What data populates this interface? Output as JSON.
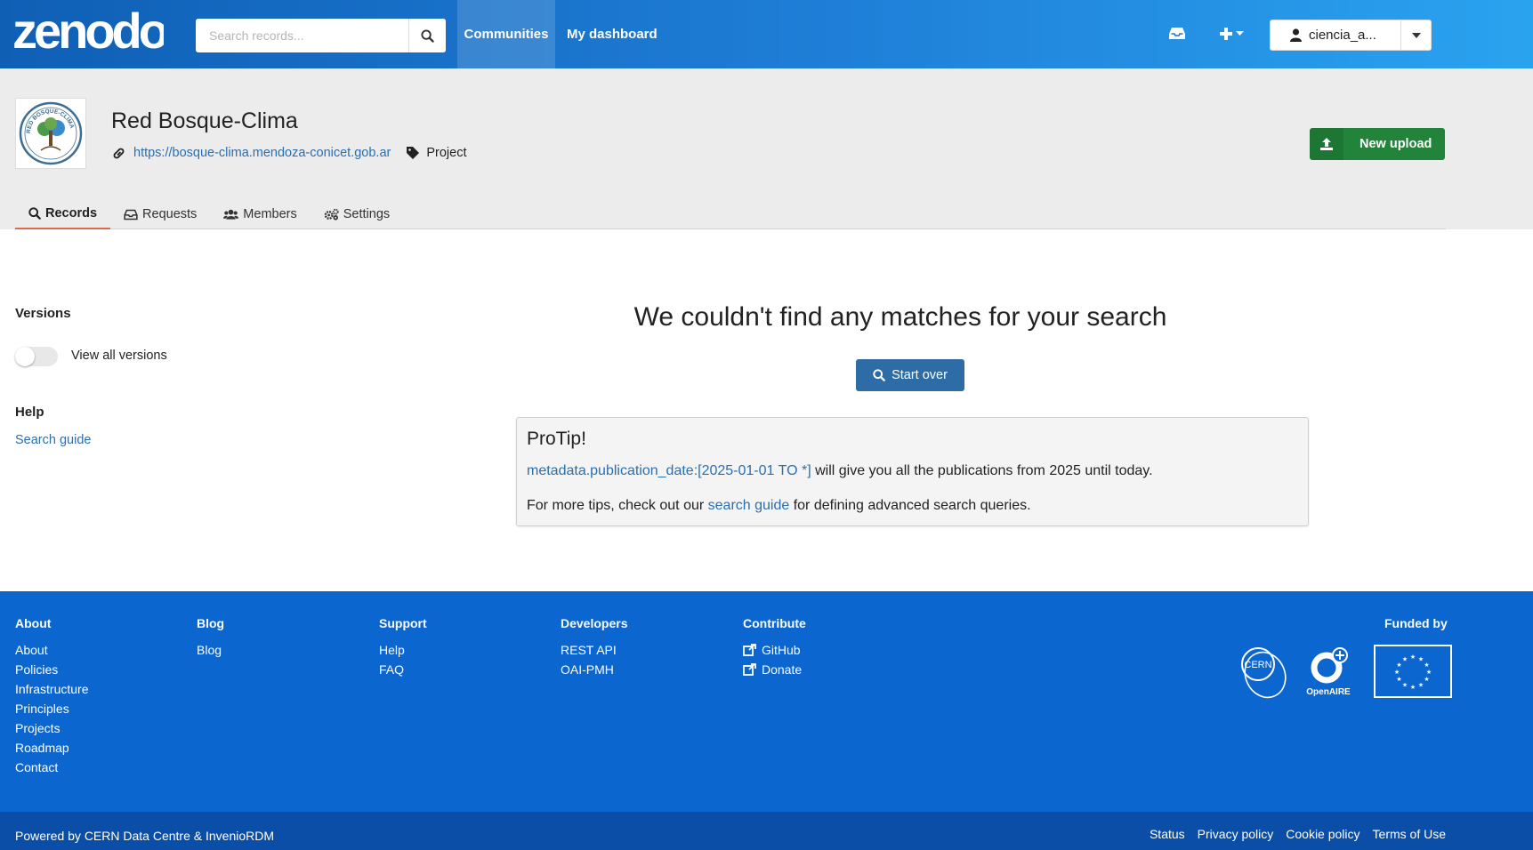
{
  "header": {
    "logo_text": "zenodo",
    "search_placeholder": "Search records...",
    "nav": {
      "communities": "Communities",
      "dashboard": "My dashboard"
    },
    "user": "ciencia_a..."
  },
  "community": {
    "title": "Red Bosque-Clima",
    "logo_text": "RED BOSQUE-CLIMA",
    "url": "https://bosque-clima.mendoza-conicet.gob.ar",
    "type": "Project",
    "new_upload": "New upload",
    "tabs": [
      {
        "label": "Records",
        "icon": "search-icon",
        "active": true
      },
      {
        "label": "Requests",
        "icon": "inbox-icon",
        "active": false
      },
      {
        "label": "Members",
        "icon": "users-icon",
        "active": false
      },
      {
        "label": "Settings",
        "icon": "cogs-icon",
        "active": false
      }
    ]
  },
  "sidebar": {
    "versions_heading": "Versions",
    "versions_toggle": "View all versions",
    "versions_toggle_on": false,
    "help_heading": "Help",
    "help_link": "Search guide"
  },
  "main": {
    "empty_title": "We couldn't find any matches for your search",
    "start_over": "Start over",
    "protip": {
      "title": "ProTip!",
      "query": "metadata.publication_date:[2025-01-01 TO *]",
      "line1_rest": " will give you all the publications from 2025 until today.",
      "line2_pre": "For more tips, check out our ",
      "line2_link": "search guide",
      "line2_post": " for defining advanced search queries."
    }
  },
  "footer": {
    "columns": [
      {
        "heading": "About",
        "items": [
          "About",
          "Policies",
          "Infrastructure",
          "Principles",
          "Projects",
          "Roadmap",
          "Contact"
        ]
      },
      {
        "heading": "Blog",
        "items": [
          "Blog"
        ]
      },
      {
        "heading": "Support",
        "items": [
          "Help",
          "FAQ"
        ]
      },
      {
        "heading": "Developers",
        "items": [
          "REST API",
          "OAI-PMH"
        ]
      },
      {
        "heading": "Contribute",
        "items": [
          "GitHub",
          "Donate"
        ]
      }
    ],
    "funded_by": "Funded by",
    "funder_labels": {
      "cern": "CERN",
      "openaire": "OpenAIRE"
    },
    "powered_by": "Powered by CERN Data Centre & InvenioRDM",
    "bottom_links": [
      "Status",
      "Privacy policy",
      "Cookie policy",
      "Terms of Use"
    ]
  },
  "colors": {
    "header_gradient": [
      "#0f5fb5",
      "#2aa3ef"
    ],
    "new_upload_green": "#21843a",
    "start_over_blue": "#2e6ca6",
    "footer_blue": "#0b66cf",
    "active_tab_underline": "#e0674b"
  }
}
